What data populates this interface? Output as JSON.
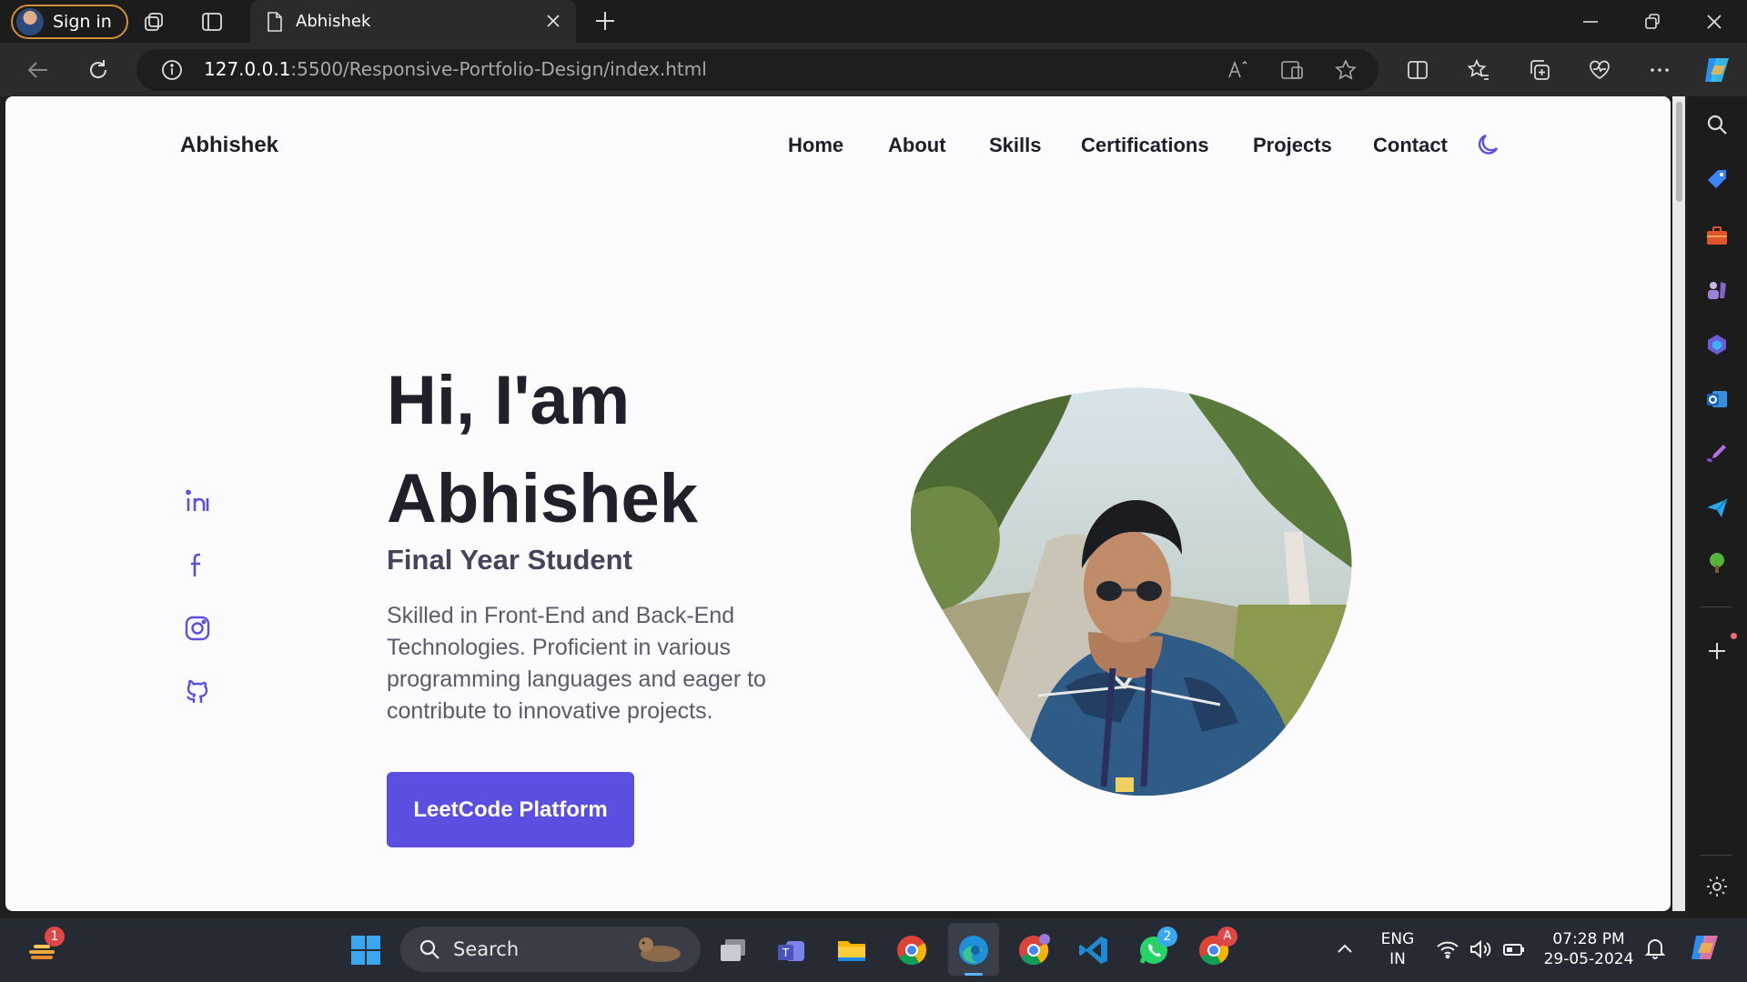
{
  "browser": {
    "sign_in": "Sign in",
    "tab_title": "Abhishek",
    "url_host": "127.0.0.1",
    "url_rest": ":5500/Responsive-Portfolio-Design/index.html"
  },
  "site": {
    "logo": "Abhishek",
    "nav": [
      "Home",
      "About",
      "Skills",
      "Certifications",
      "Projects",
      "Contact"
    ],
    "hero": {
      "greeting": "Hi, I'am",
      "name": "Abhishek",
      "role": "Final Year Student",
      "description": "Skilled in Front-End and Back-End Technologies. Proficient in various programming languages and eager to contribute to innovative projects.",
      "button": "LeetCode Platform"
    },
    "social_icons": [
      "linkedin-icon",
      "facebook-icon",
      "instagram-icon",
      "github-icon"
    ],
    "accent": "#5a4fe0"
  },
  "taskbar": {
    "search_placeholder": "Search",
    "lang_top": "ENG",
    "lang_bottom": "IN",
    "time": "07:28 PM",
    "date": "29-05-2024",
    "badge_widgets": "1",
    "badge_whatsapp": "2",
    "badge_chrome": "A"
  }
}
